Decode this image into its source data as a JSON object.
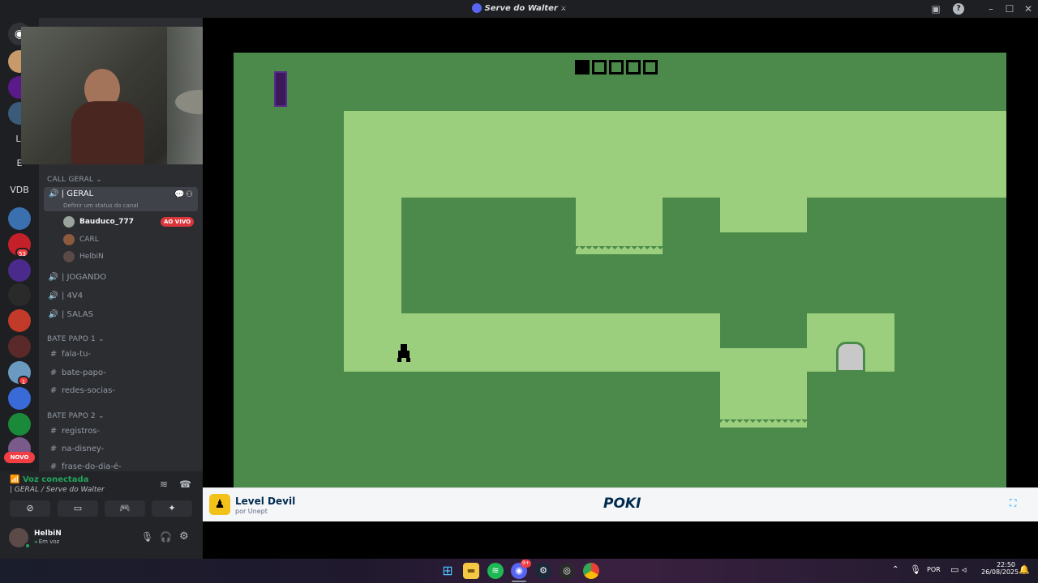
{
  "window": {
    "title": "Serve do Walter",
    "title_glyph": "⚔"
  },
  "titlebar_controls": {
    "minimize": "–",
    "maximize": "☐",
    "close": "✕"
  },
  "servers": {
    "text_items": [
      "LI",
      "E",
      "VDB"
    ],
    "badges": {
      "lol_count": "53",
      "pieces_count": "1",
      "new_label": "NOVO"
    }
  },
  "channels": {
    "categories": {
      "call_geral": "CALL GERAL",
      "bate_papo_1": "BATE PAPO 1",
      "bate_papo_2": "BATE PAPO 2"
    },
    "voice": [
      {
        "name": "| GERAL",
        "status": "Definir um status do canal"
      },
      {
        "name": "| JOGANDO"
      },
      {
        "name": "| 4V4"
      },
      {
        "name": "| SALAS"
      }
    ],
    "voice_users": [
      {
        "name": "Bauduco_777",
        "live": "AO VIVO",
        "color": "#9aa39c"
      },
      {
        "name": "CARL",
        "color": "#8c5a3c"
      },
      {
        "name": "HelbiN",
        "color": "#5b4a48"
      }
    ],
    "text_channels_1": [
      "fala-tu-",
      "bate-papo-",
      "redes-socias-"
    ],
    "text_channels_2": [
      "registros-",
      "na-disney-",
      "frase-do-dia-é-"
    ]
  },
  "voice_panel": {
    "status": "Voz conectada",
    "location": "| GERAL / Serve do Walter"
  },
  "user_panel": {
    "name": "HelbiN",
    "status": "Em voz"
  },
  "game": {
    "level_boxes": [
      true,
      false,
      false,
      false,
      false
    ],
    "colors": {
      "dark": "#4b8a4a",
      "light": "#9ccf7d",
      "door": "#c8c8c8"
    }
  },
  "poki": {
    "game_title": "Level Devil",
    "developer": "por Unept",
    "logo": "POKI"
  },
  "taskbar": {
    "tray_lang": "POR",
    "time": "22:50",
    "date": "26/08/2025",
    "discord_badge": "9+"
  }
}
